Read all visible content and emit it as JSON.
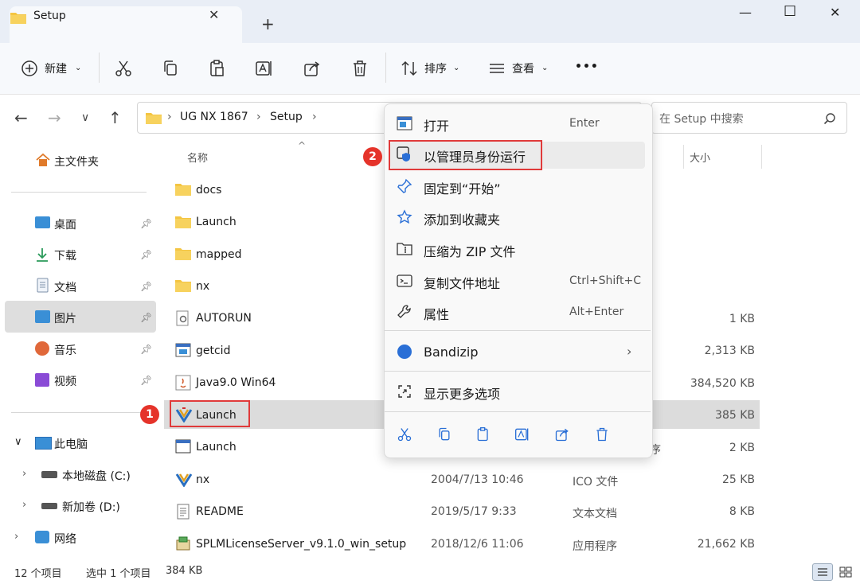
{
  "window": {
    "tab_title": "Setup",
    "tab_close": "✕",
    "new_tab": "+",
    "minimize": "—",
    "maximize": "☐",
    "close": "✕"
  },
  "toolbar": {
    "new_label": "新建",
    "sort_label": "排序",
    "view_label": "查看",
    "more_label": "•••"
  },
  "address": {
    "crumbs": [
      "UG NX 1867",
      "Setup"
    ],
    "search_placeholder": "在 Setup 中搜索"
  },
  "sidebar": {
    "home": "主文件夹",
    "quick": [
      {
        "label": "桌面"
      },
      {
        "label": "下载"
      },
      {
        "label": "文档"
      },
      {
        "label": "图片"
      },
      {
        "label": "音乐"
      },
      {
        "label": "视频"
      }
    ],
    "this_pc": "此电脑",
    "drives": [
      {
        "label": "本地磁盘 (C:)"
      },
      {
        "label": "新加卷 (D:)"
      }
    ],
    "network": "网络"
  },
  "columns": {
    "name": "名称",
    "size": "大小"
  },
  "files": [
    {
      "name": "docs",
      "date": "",
      "type": "",
      "size": ""
    },
    {
      "name": "Launch",
      "date": "",
      "type": "",
      "size": ""
    },
    {
      "name": "mapped",
      "date": "",
      "type": "",
      "size": ""
    },
    {
      "name": "nx",
      "date": "",
      "type": "",
      "size": ""
    },
    {
      "name": "AUTORUN",
      "date": "",
      "type": "",
      "size": "1 KB"
    },
    {
      "name": "getcid",
      "date": "",
      "type": "",
      "size": "2,313 KB"
    },
    {
      "name": "Java9.0 Win64",
      "date": "",
      "type": "",
      "size": "384,520 KB"
    },
    {
      "name": "Launch",
      "date": "",
      "type": "",
      "size": "385 KB"
    },
    {
      "name": "Launch",
      "date": "",
      "type": "序",
      "size": "2 KB"
    },
    {
      "name": "nx",
      "date": "2004/7/13 10:46",
      "type": "ICO 文件",
      "size": "25 KB"
    },
    {
      "name": "README",
      "date": "2019/5/17 9:33",
      "type": "文本文档",
      "size": "8 KB"
    },
    {
      "name": "SPLMLicenseServer_v9.1.0_win_setup",
      "date": "2018/12/6 11:06",
      "type": "应用程序",
      "size": "21,662 KB"
    }
  ],
  "menu": {
    "items": [
      {
        "label": "打开",
        "key": "Enter"
      },
      {
        "label": "以管理员身份运行",
        "key": ""
      },
      {
        "label": "固定到“开始”",
        "key": ""
      },
      {
        "label": "添加到收藏夹",
        "key": ""
      },
      {
        "label": "压缩为 ZIP 文件",
        "key": ""
      },
      {
        "label": "复制文件地址",
        "key": "Ctrl+Shift+C"
      },
      {
        "label": "属性",
        "key": "Alt+Enter"
      },
      {
        "label": "Bandizip",
        "key": "›"
      },
      {
        "label": "显示更多选项",
        "key": ""
      }
    ]
  },
  "badges": {
    "one": "1",
    "two": "2"
  },
  "status": {
    "count": "12 个项目",
    "selected": "选中 1 个项目",
    "size": "384 KB"
  },
  "colors": {
    "accent": "#e5332a",
    "folder": "#f4c542",
    "selection": "#dcdcdc"
  }
}
